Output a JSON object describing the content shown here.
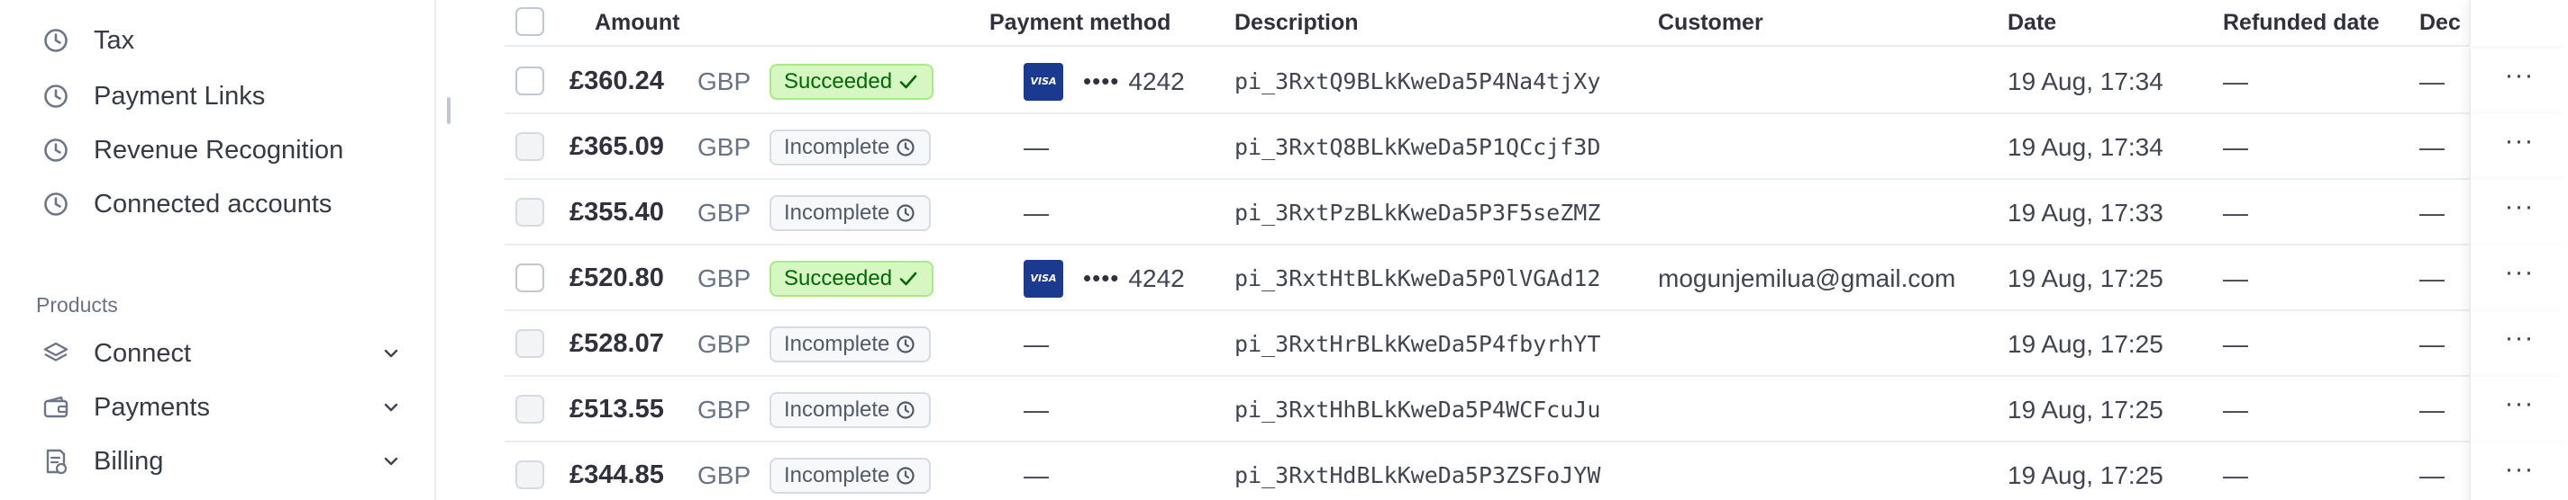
{
  "sidebar": {
    "items": [
      {
        "label": "Tax",
        "icon": "clock-icon"
      },
      {
        "label": "Payment Links",
        "icon": "clock-icon"
      },
      {
        "label": "Revenue Recognition",
        "icon": "clock-icon"
      },
      {
        "label": "Connected accounts",
        "icon": "clock-icon"
      }
    ],
    "section_label": "Products",
    "products": [
      {
        "label": "Connect",
        "icon": "layers-icon"
      },
      {
        "label": "Payments",
        "icon": "wallet-icon"
      },
      {
        "label": "Billing",
        "icon": "invoice-icon"
      }
    ]
  },
  "table": {
    "headers": {
      "amount": "Amount",
      "payment_method": "Payment method",
      "description": "Description",
      "customer": "Customer",
      "date": "Date",
      "refunded_date": "Refunded date",
      "declined": "Dec"
    },
    "rows": [
      {
        "amount": "£360.24",
        "currency": "GBP",
        "status": "Succeeded",
        "pm_brand": "VISA",
        "pm_dots": "••••",
        "pm_last4": "4242",
        "pm_empty": "",
        "description": "pi_3RxtQ9BLkKweDa5P4Na4tjXy",
        "customer": "",
        "date": "19 Aug, 17:34",
        "refunded": "—",
        "declined": "—"
      },
      {
        "amount": "£365.09",
        "currency": "GBP",
        "status": "Incomplete",
        "pm_brand": "",
        "pm_dots": "",
        "pm_last4": "",
        "pm_empty": "—",
        "description": "pi_3RxtQ8BLkKweDa5P1QCcjf3D",
        "customer": "",
        "date": "19 Aug, 17:34",
        "refunded": "—",
        "declined": "—"
      },
      {
        "amount": "£355.40",
        "currency": "GBP",
        "status": "Incomplete",
        "pm_brand": "",
        "pm_dots": "",
        "pm_last4": "",
        "pm_empty": "—",
        "description": "pi_3RxtPzBLkKweDa5P3F5seZMZ",
        "customer": "",
        "date": "19 Aug, 17:33",
        "refunded": "—",
        "declined": "—"
      },
      {
        "amount": "£520.80",
        "currency": "GBP",
        "status": "Succeeded",
        "pm_brand": "VISA",
        "pm_dots": "••••",
        "pm_last4": "4242",
        "pm_empty": "",
        "description": "pi_3RxtHtBLkKweDa5P0lVGAd12",
        "customer": "mogunjemilua@gmail.com",
        "date": "19 Aug, 17:25",
        "refunded": "—",
        "declined": "—"
      },
      {
        "amount": "£528.07",
        "currency": "GBP",
        "status": "Incomplete",
        "pm_brand": "",
        "pm_dots": "",
        "pm_last4": "",
        "pm_empty": "—",
        "description": "pi_3RxtHrBLkKweDa5P4fbyrhYT",
        "customer": "",
        "date": "19 Aug, 17:25",
        "refunded": "—",
        "declined": "—"
      },
      {
        "amount": "£513.55",
        "currency": "GBP",
        "status": "Incomplete",
        "pm_brand": "",
        "pm_dots": "",
        "pm_last4": "",
        "pm_empty": "—",
        "description": "pi_3RxtHhBLkKweDa5P4WCFcuJu",
        "customer": "",
        "date": "19 Aug, 17:25",
        "refunded": "—",
        "declined": "—"
      },
      {
        "amount": "£344.85",
        "currency": "GBP",
        "status": "Incomplete",
        "pm_brand": "",
        "pm_dots": "",
        "pm_last4": "",
        "pm_empty": "—",
        "description": "pi_3RxtHdBLkKweDa5P3ZSFoJYW",
        "customer": "",
        "date": "19 Aug, 17:25",
        "refunded": "—",
        "declined": "—"
      }
    ],
    "more_glyph": "···"
  },
  "colors": {
    "succeeded_bg": "#d7f7c2",
    "succeeded_text": "#006908",
    "incomplete_bg": "#f6f8fa",
    "visa_blue": "#1a3a8f"
  }
}
